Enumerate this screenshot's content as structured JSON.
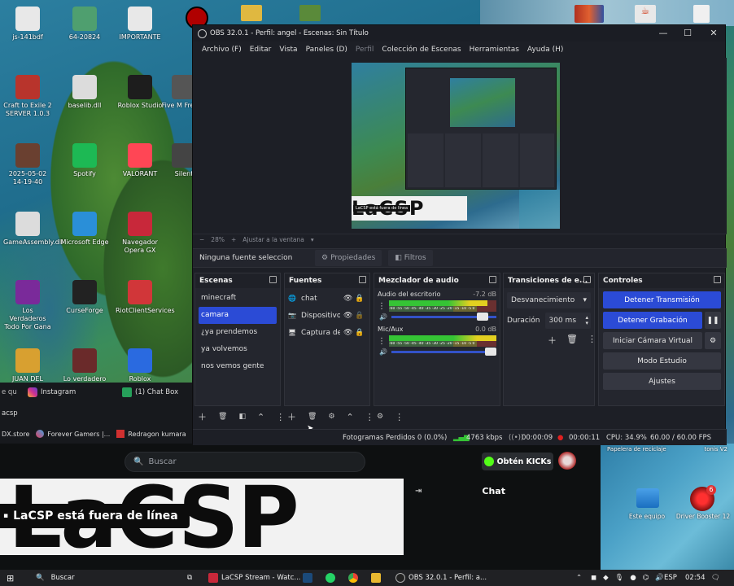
{
  "desktop": {
    "icons": [
      {
        "label": "js-141bdf",
        "color": "#e8e8e8"
      },
      {
        "label": "64-20824",
        "color": "#4f9f6f"
      },
      {
        "label": "IMPORTANTE",
        "color": "#e8e8e8"
      },
      {
        "label": "Craft to Exile 2 SERVER 1.0.3",
        "color": "#b8342c"
      },
      {
        "label": "baselib.dll",
        "color": "#dcdcdc"
      },
      {
        "label": "Roblox Studio",
        "color": "#1d1d1d"
      },
      {
        "label": "Five M Freddy",
        "color": "#555"
      },
      {
        "label": "2025-05-02 14-19-40",
        "color": "#6a4030"
      },
      {
        "label": "Spotify",
        "color": "#1db954"
      },
      {
        "label": "VALORANT",
        "color": "#ff4655"
      },
      {
        "label": "Silent",
        "color": "#444"
      },
      {
        "label": "GameAssembly.dll",
        "color": "#dcdcdc"
      },
      {
        "label": "Microsoft Edge",
        "color": "#2a8fd8"
      },
      {
        "label": "Navegador Opera GX",
        "color": "#c8283a"
      },
      {
        "label": "Los Verdaderos Todo Por Gana",
        "color": "#7a2a9a"
      },
      {
        "label": "CurseForge",
        "color": "#222"
      },
      {
        "label": "RiotClientServices",
        "color": "#d13639"
      },
      {
        "label": "JUAN DEL",
        "color": "#d8a030"
      },
      {
        "label": "Lo verdadero",
        "color": "#6a2a2a"
      },
      {
        "label": "Roblox",
        "color": "#2a6ae0"
      }
    ],
    "right_icons": [
      {
        "label": "Papelera de reciclaje"
      },
      {
        "label": "tonis V2"
      },
      {
        "label": "Este equipo"
      },
      {
        "label": "Driver Booster 12",
        "badge": "6"
      }
    ]
  },
  "obs": {
    "title": "OBS 32.0.1 - Perfil: angel - Escenas: Sin Título",
    "menu": [
      "Archivo (F)",
      "Editar",
      "Vista",
      "Paneles (D)",
      "Perfil",
      "Colección de Escenas",
      "Herramientas",
      "Ayuda (H)"
    ],
    "preview_banner": "LaCSP",
    "preview_tag": "LaCSP está fuera de línea",
    "zoom": {
      "minus": "−",
      "value": "28%",
      "plus": "+",
      "fit": "Ajustar a la ventana",
      "dropdown": "▾"
    },
    "source_bar": {
      "none": "Ninguna fuente seleccionada",
      "props": "Propiedades",
      "filters": "Filtros"
    },
    "scenes": {
      "title": "Escenas",
      "items": [
        "minecraft",
        "camara",
        "¿ya prendemos",
        "ya volvemos",
        "nos vemos gente"
      ],
      "selected": 1
    },
    "sources": {
      "title": "Fuentes",
      "items": [
        {
          "name": "chat",
          "icon": "🌐"
        },
        {
          "name": "Dispositivo de captura de vídeo",
          "icon": "📷"
        },
        {
          "name": "Captura de pantalla",
          "icon": "🖥"
        }
      ]
    },
    "mixer": {
      "title": "Mezclador de audio",
      "channels": [
        {
          "name": "Audio del escritorio",
          "db": "-7.2 dB",
          "level": 0.92
        },
        {
          "name": "Mic/Aux",
          "db": "0.0 dB",
          "level": 1.0
        }
      ],
      "scale": "-60 -55 -50 -45 -40 -35 -30 -25 -20 -15 -10 -5 0"
    },
    "transitions": {
      "title": "Transiciones de e...",
      "type": "Desvanecimiento",
      "duration_label": "Duración",
      "duration": "300 ms"
    },
    "controls": {
      "title": "Controles",
      "buttons": [
        "Detener Transmisión",
        "Detener Grabación",
        "Iniciar Cámara Virtual",
        "Modo Estudio",
        "Ajustes"
      ]
    },
    "status": {
      "dropped": "Fotogramas Perdidos 0 (0.0%)",
      "kbps": "4763 kbps",
      "stream_time": "00:00:09",
      "rec_time": "00:00:11",
      "cpu": "CPU: 34.9%",
      "fps": "60.00 / 60.00 FPS"
    }
  },
  "browser": {
    "tabs": [
      "e qu",
      "Instagram",
      "(1) Chat Box"
    ],
    "address_fragment": "acsp",
    "bookmarks": [
      "DX.store",
      "Forever Gamers |...",
      "Redragon kumara"
    ],
    "search_placeholder": "Buscar",
    "kicks_button": "Obtén KICKs",
    "offline_banner": "LaCSP",
    "offline_text": "LaCSP está fuera de línea",
    "chat_title": "Chat"
  },
  "taskbar": {
    "search": "Buscar",
    "apps": [
      {
        "label": "LaCSP Stream - Watc...",
        "color": "#c8283a"
      },
      {
        "label": "OBS 32.0.1 - Perfil: a...",
        "color": "#222"
      }
    ],
    "lang": "ESP",
    "time": "02:54"
  }
}
